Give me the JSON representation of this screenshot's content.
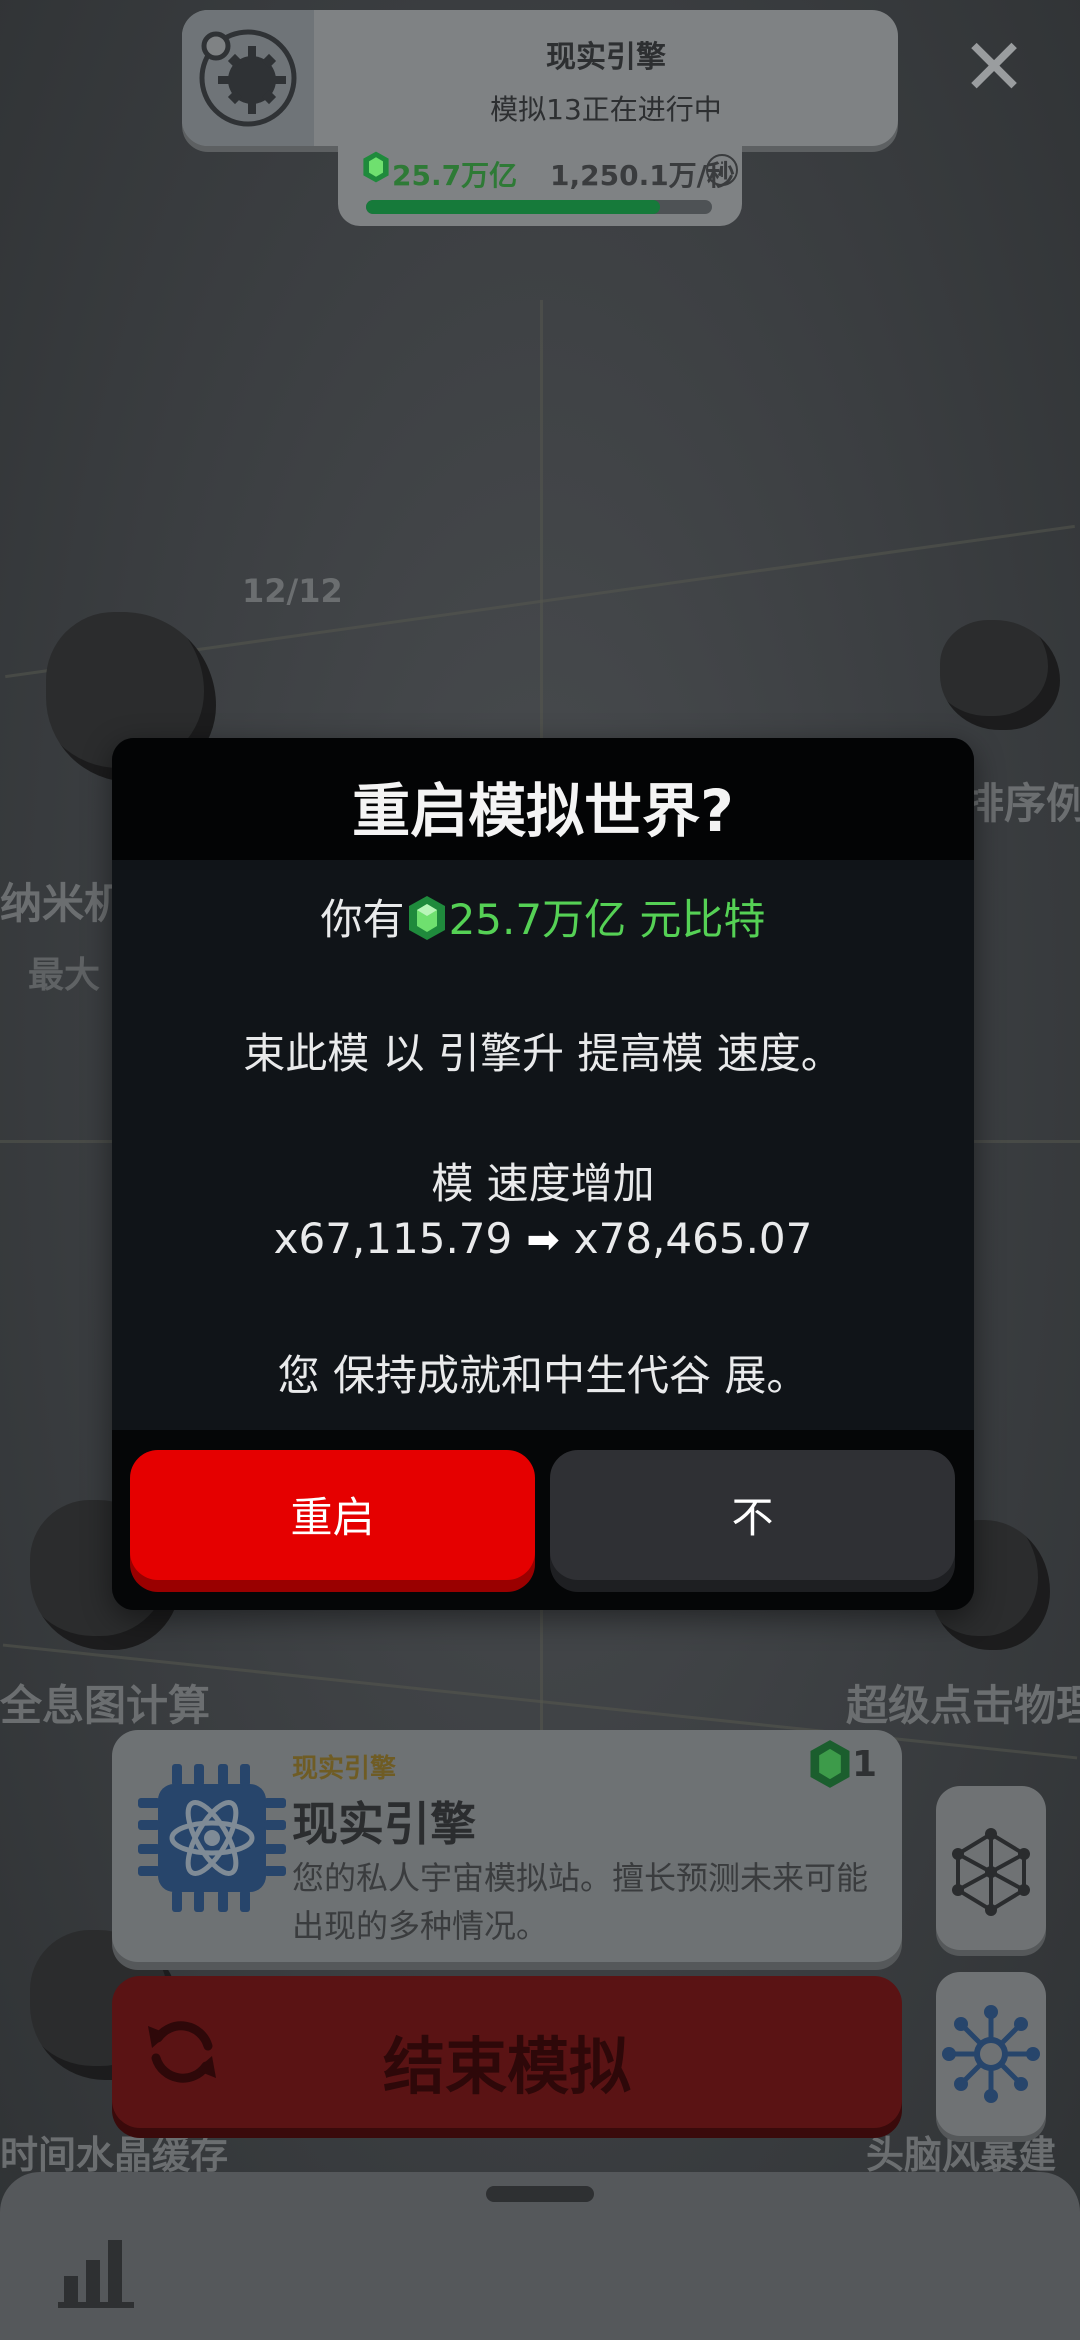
{
  "header": {
    "title": "现实引擎",
    "subtitle": "模拟13正在进行中"
  },
  "resource": {
    "value": "25.7万亿",
    "rate": "1,250.1万/秒",
    "info_symbol": "i",
    "progress_percent": 85
  },
  "background": {
    "counter": "12/12",
    "node_labels": [
      "纳米机",
      "最大",
      "排序例",
      "全息图计算",
      "超级点击物理",
      "时间水晶缓存",
      "头脑风暴建"
    ]
  },
  "dialog": {
    "title": "重启模拟世界?",
    "have_prefix": "你有",
    "have_amount": "25.7万亿 元比特",
    "description": "束此模 以  引擎升  提高模 速度。",
    "speed_title": "模 速度增加",
    "speed_from": "x67,115.79",
    "speed_to": "x78,465.07",
    "keep_text": "您 保持成就和中生代谷 展。",
    "restart_button": "重启",
    "no_button": "不"
  },
  "engine_card": {
    "tag": "现实引擎",
    "title": "现实引擎",
    "description": "您的私人宇宙模拟站。擅长预测未来可能出现的多种情况。",
    "count": "1"
  },
  "end_button": {
    "label": "结束模拟"
  },
  "icons": {
    "header": "cog-icon",
    "close": "close-icon",
    "gem": "gem-icon",
    "arrow": "arrow-right-icon",
    "engine": "atom-chip-icon",
    "end": "refresh-icon",
    "side_top": "network-sphere-icon",
    "side_bottom": "neural-icon",
    "stats": "bar-chart-icon"
  },
  "colors": {
    "restart_red": "#e50000",
    "gem_green": "#55d155",
    "no_gray": "#2f3034"
  }
}
